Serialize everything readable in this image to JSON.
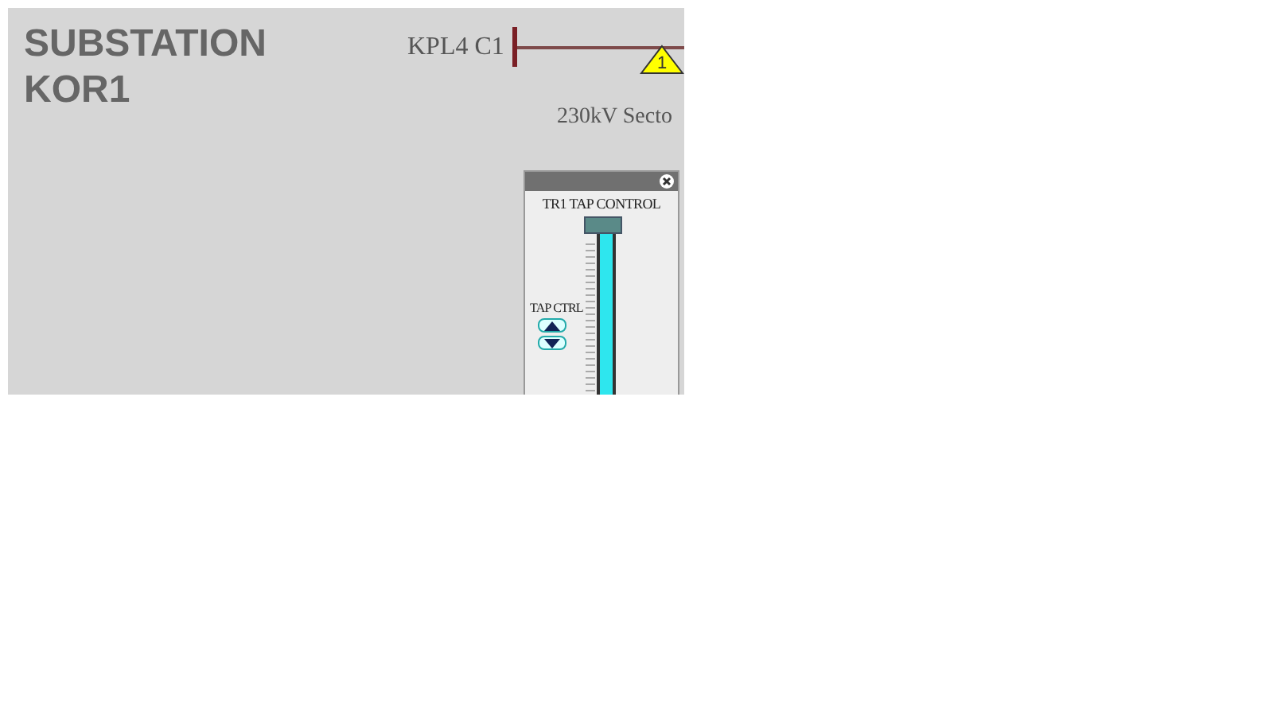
{
  "title": "SUBSTATION\nKOR1",
  "bus": {
    "label": "KPL4 C1",
    "section_label": "230kV Secto",
    "marker": "1"
  },
  "tap_control": {
    "title": "TR1 TAP CONTROL",
    "control_label": "TAP CTRL",
    "level": 1
  }
}
